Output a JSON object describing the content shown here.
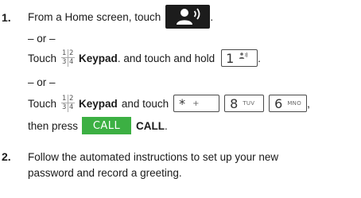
{
  "steps": [
    {
      "number": "1.",
      "line1": {
        "text": "From a Home screen, touch",
        "icon": "voicemail-icon",
        "after": "."
      },
      "or1": "– or –",
      "line2": {
        "pre": "Touch",
        "keypad_digits": [
          "1",
          "2",
          "3",
          "4"
        ],
        "keypad_label": "Keypad",
        "mid": ". and touch and hold",
        "key": {
          "main": "1",
          "sub": "voicemail-glyph"
        },
        "after": "."
      },
      "or2": "– or –",
      "line3": {
        "pre": "Touch",
        "keypad_digits": [
          "1",
          "2",
          "3",
          "4"
        ],
        "keypad_label": "Keypad",
        "mid": "and touch",
        "keys": [
          {
            "main": "*",
            "sub": "+"
          },
          {
            "main": "8",
            "sub": "TUV"
          },
          {
            "main": "6",
            "sub": "MNO"
          }
        ],
        "after": ","
      },
      "line4": {
        "pre": "then press",
        "call_button": "CALL",
        "call_label": "CALL",
        "after": "."
      }
    },
    {
      "number": "2.",
      "text_line1": "Follow the automated instructions to set up your new",
      "text_line2": "password and record a greeting."
    }
  ],
  "colors": {
    "call_green": "#3cb043",
    "icon_dark": "#1c1c1c"
  }
}
